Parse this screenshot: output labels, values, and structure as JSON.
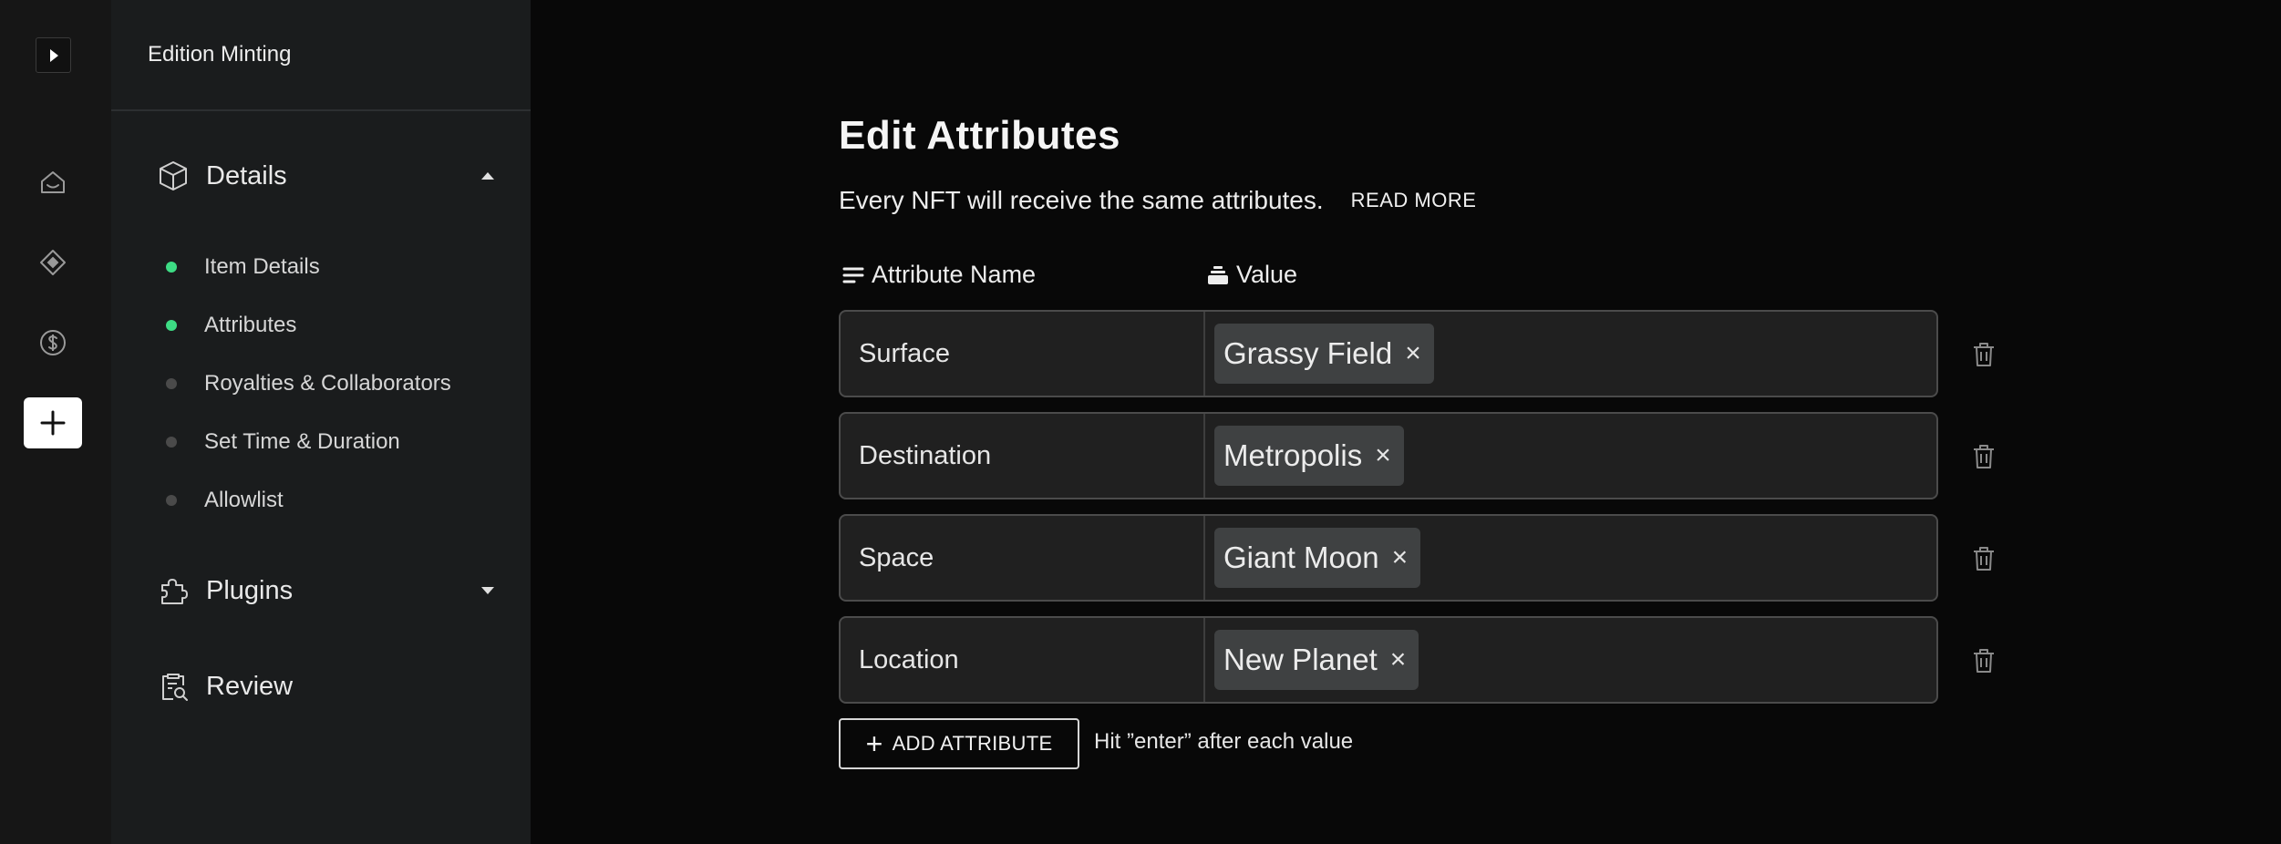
{
  "rail": {
    "toggle_icon": "play-triangle-icon",
    "items": [
      {
        "icon": "home-icon"
      },
      {
        "icon": "diamond-icon"
      },
      {
        "icon": "dollar-icon"
      },
      {
        "icon": "plus-icon",
        "active": true
      }
    ]
  },
  "sidebar": {
    "header": "Edition Minting",
    "sections": [
      {
        "label": "Details",
        "icon": "cube-icon",
        "expanded": true
      },
      {
        "label": "Plugins",
        "icon": "puzzle-icon",
        "expanded": false
      },
      {
        "label": "Review",
        "icon": "clipboard-search-icon"
      }
    ],
    "sub_items": [
      {
        "label": "Item Details",
        "done": true
      },
      {
        "label": "Attributes",
        "done": true
      },
      {
        "label": "Royalties & Collaborators",
        "done": false
      },
      {
        "label": "Set Time & Duration",
        "done": false
      },
      {
        "label": "Allowlist",
        "done": false
      }
    ]
  },
  "main": {
    "title": "Edit Attributes",
    "subtitle": "Every NFT will receive the same attributes.",
    "read_more": "READ MORE",
    "columns": {
      "name": "Attribute Name",
      "value": "Value"
    },
    "attributes": [
      {
        "name": "Surface",
        "value": "Grassy Field"
      },
      {
        "name": "Destination",
        "value": "Metropolis"
      },
      {
        "name": "Space",
        "value": "Giant Moon"
      },
      {
        "name": "Location",
        "value": "New Planet"
      }
    ],
    "chip_remove": "×",
    "add_button": "ADD ATTRIBUTE",
    "add_button_icon": "+",
    "hint": "Hit ”enter” after each value"
  },
  "colors": {
    "accent_done": "#3ddc84",
    "background": "#080808",
    "sidebar": "#1a1c1d",
    "rail": "#161616"
  }
}
